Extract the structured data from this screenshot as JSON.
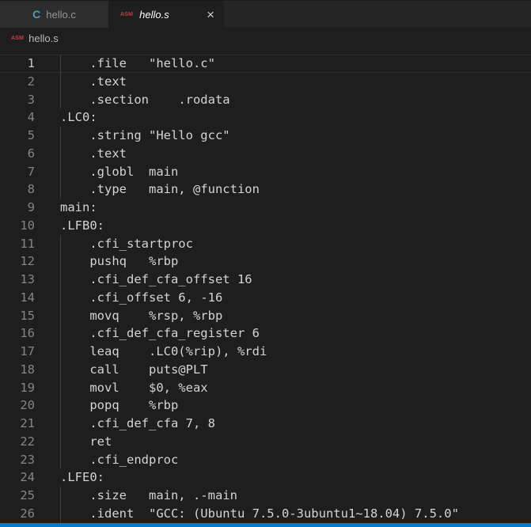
{
  "colors": {
    "editor_bg": "#1e1e1e",
    "tabbar_bg": "#252526",
    "tab_inactive_bg": "#2d2d2d",
    "tab_active_bg": "#1e1e1e",
    "accent_blue": "#007acc",
    "asm_icon_red": "#c34043",
    "c_icon_blue": "#519aba",
    "code_text": "#d4d4d4",
    "line_number": "#858585",
    "line_number_current": "#c6c6c6"
  },
  "tabs": [
    {
      "label": "hello.c",
      "icon_text": "C",
      "active": false
    },
    {
      "label": "hello.s",
      "icon_text": "ASM",
      "active": true,
      "close_label": "×"
    }
  ],
  "breadcrumb": {
    "icon_text": "ASM",
    "label": "hello.s"
  },
  "editor": {
    "current_line": 1,
    "lines": [
      "\t.file\t\"hello.c\"",
      "\t.text",
      "\t.section\t.rodata",
      ".LC0:",
      "\t.string \"Hello gcc\"",
      "\t.text",
      "\t.globl\tmain",
      "\t.type\tmain, @function",
      "main:",
      ".LFB0:",
      "\t.cfi_startproc",
      "\tpushq\t%rbp",
      "\t.cfi_def_cfa_offset 16",
      "\t.cfi_offset 6, -16",
      "\tmovq\t%rsp, %rbp",
      "\t.cfi_def_cfa_register 6",
      "\tleaq\t.LC0(%rip), %rdi",
      "\tcall\tputs@PLT",
      "\tmovl\t$0, %eax",
      "\tpopq\t%rbp",
      "\t.cfi_def_cfa 7, 8",
      "\tret",
      "\t.cfi_endproc",
      ".LFE0:",
      "\t.size\tmain, .-main",
      "\t.ident\t\"GCC: (Ubuntu 7.5.0-3ubuntu1~18.04) 7.5.0\""
    ]
  }
}
